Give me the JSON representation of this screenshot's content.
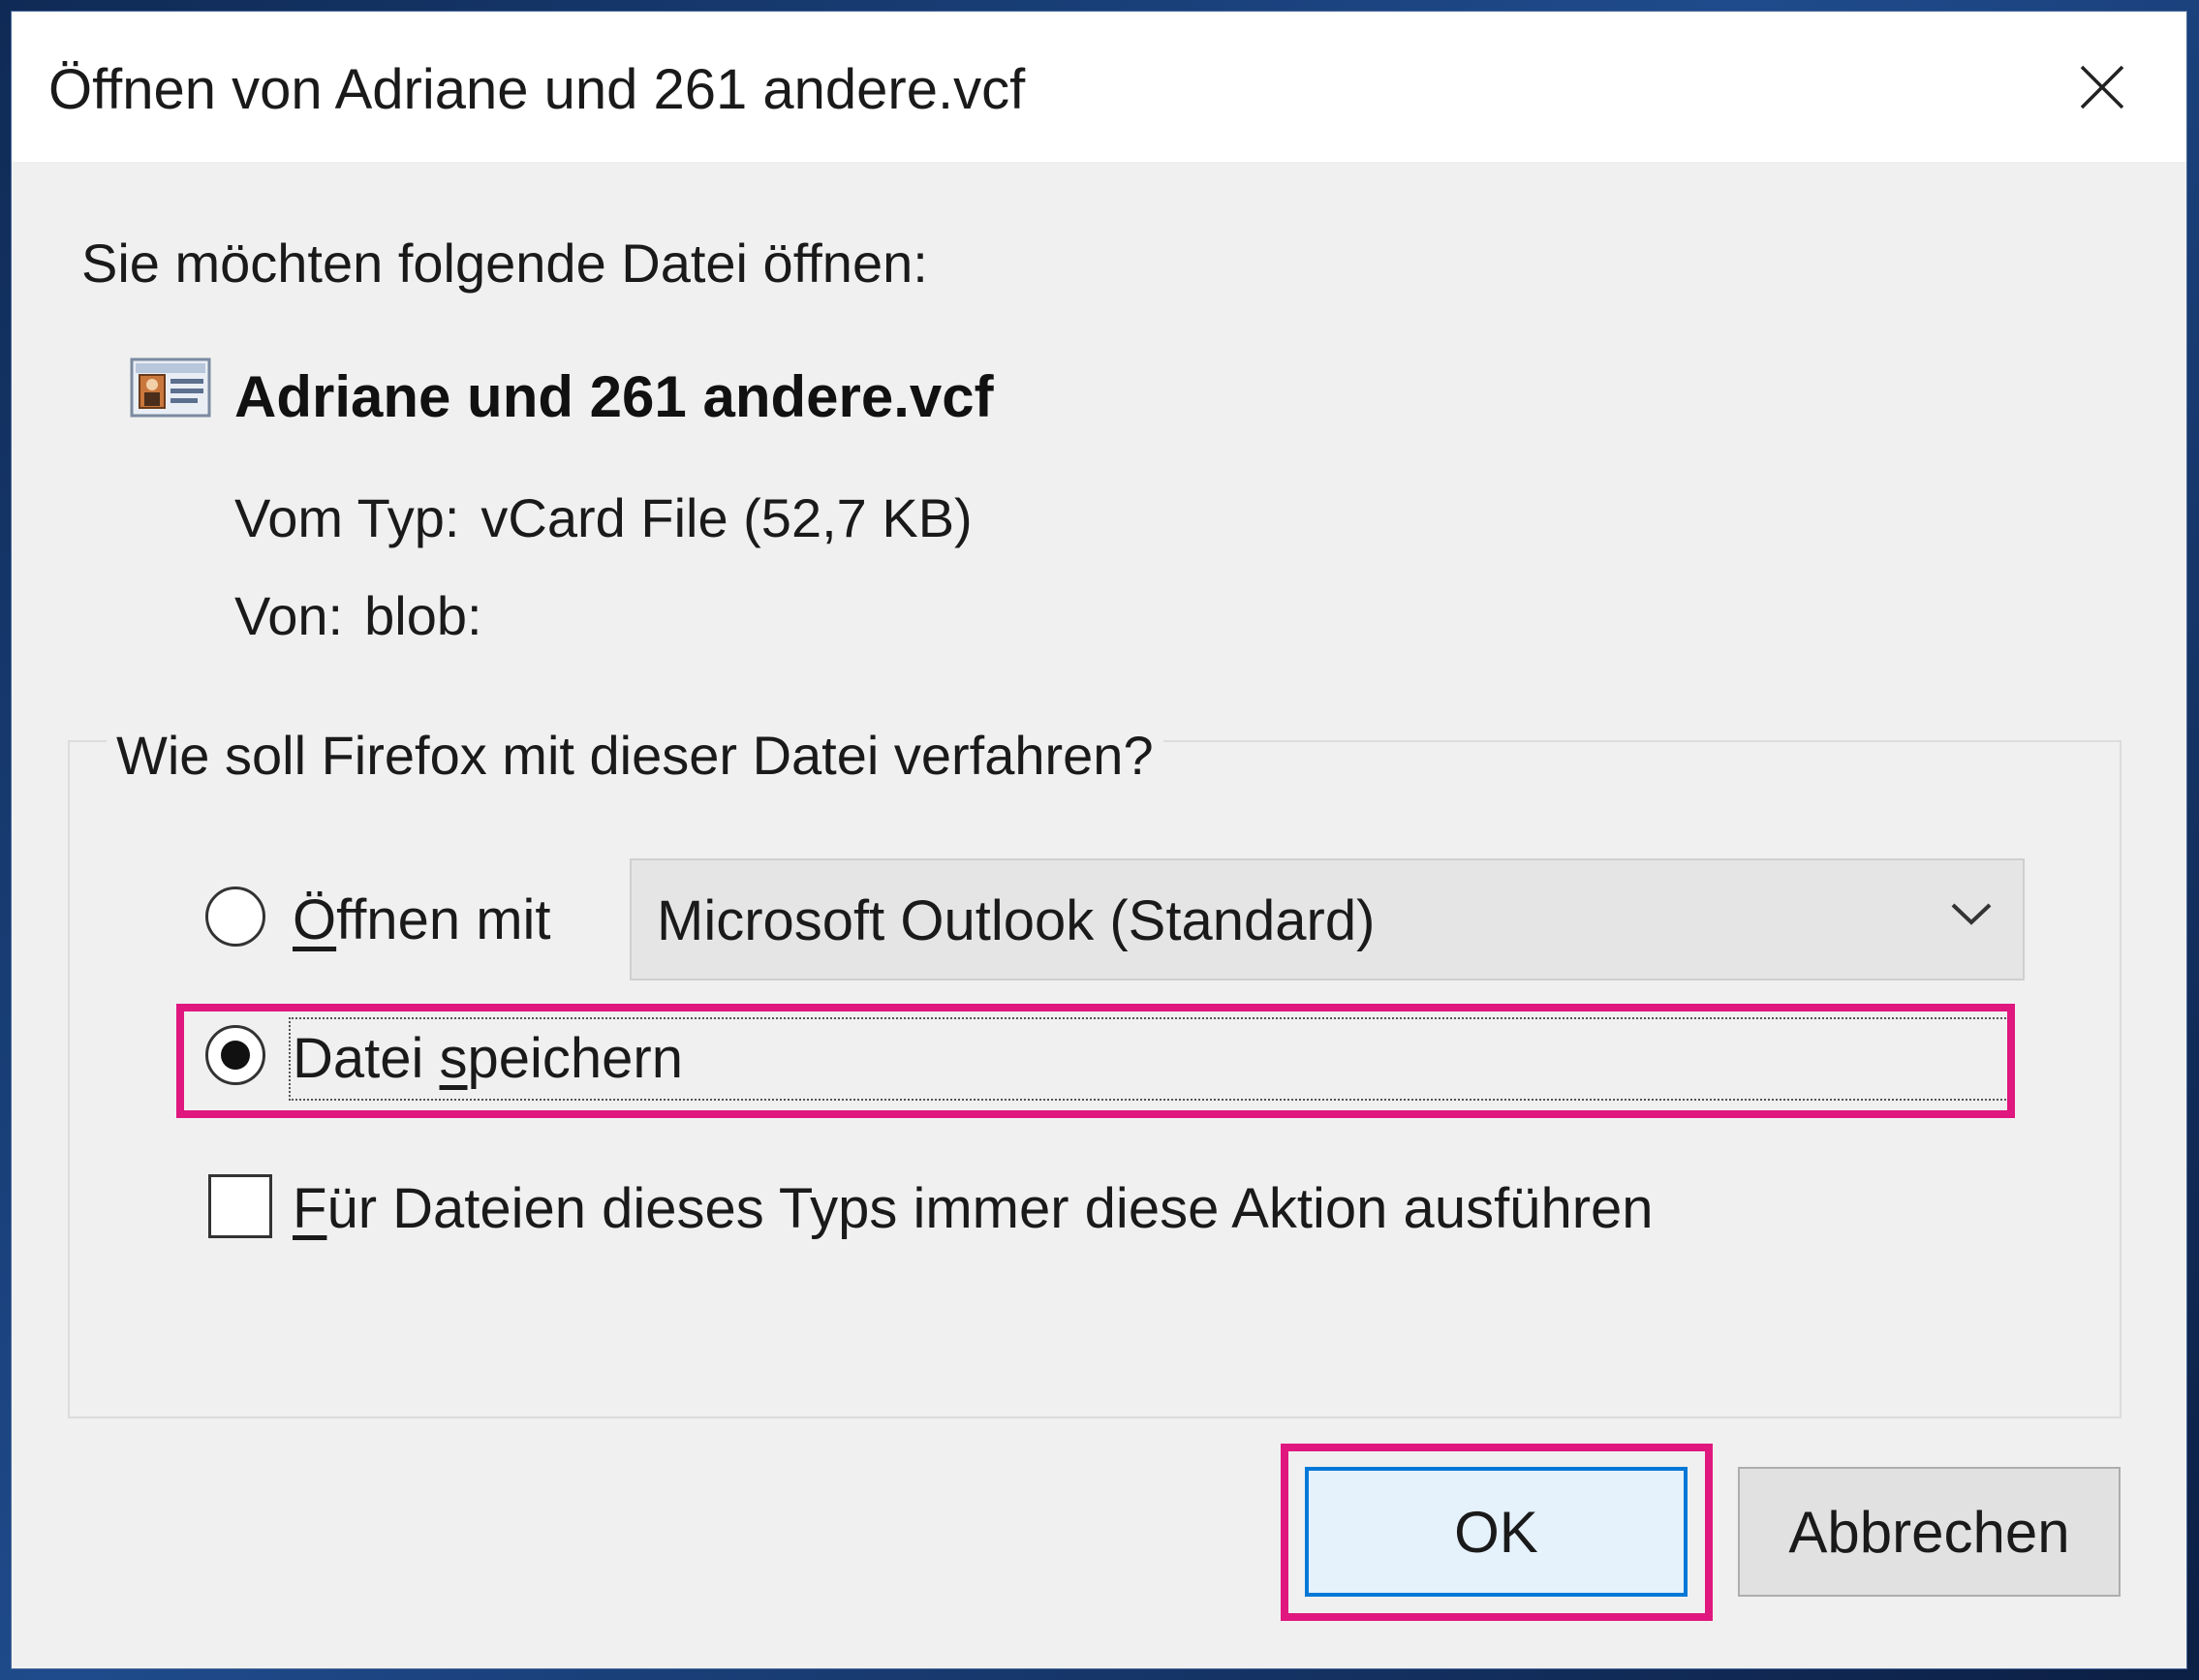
{
  "window": {
    "title": "Öffnen von Adriane und 261 andere.vcf",
    "close_label": "Schließen"
  },
  "content": {
    "prompt": "Sie möchten folgende Datei öffnen:",
    "file_name": "Adriane und 261 andere.vcf",
    "file_icon": "vcard-file-icon",
    "type_label": "Vom Typ:",
    "type_value": "vCard File (52,7 KB)",
    "from_label": "Von:",
    "from_value": "blob:"
  },
  "action_group": {
    "legend": "Wie soll Firefox mit dieser Datei verfahren?",
    "open_with": {
      "mnemonic": "Ö",
      "rest": "ffnen mit",
      "selected": false
    },
    "app_select": {
      "value": "Microsoft Outlook (Standard)"
    },
    "save_file": {
      "prefix": "Datei ",
      "mnemonic": "s",
      "rest": "peichern",
      "selected": true
    },
    "always": {
      "mnemonic": "F",
      "rest": "ür Dateien dieses Typs immer diese Aktion ausführen",
      "checked": false
    }
  },
  "buttons": {
    "ok": "OK",
    "cancel": "Abbrechen"
  },
  "colors": {
    "highlight": "#e0177f",
    "ok_border": "#0078d7",
    "dialog_bg": "#f0f0f0"
  }
}
